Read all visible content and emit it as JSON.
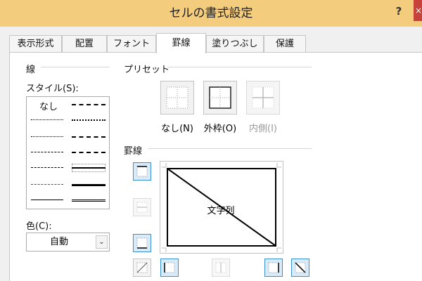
{
  "window": {
    "title": "セルの書式設定",
    "help": "?",
    "close": "×"
  },
  "tabs": [
    "表示形式",
    "配置",
    "フォント",
    "罫線",
    "塗りつぶし",
    "保護"
  ],
  "active_tab": "罫線",
  "line_group": {
    "label": "線",
    "style_label": "スタイル(S):",
    "style_none": "なし",
    "color_label": "色(C):",
    "color_value": "自動"
  },
  "preset_group": {
    "label": "プリセット",
    "none_label": "なし(N)",
    "outline_label": "外枠(O)",
    "inside_label": "内側(I)"
  },
  "border_group": {
    "label": "罫線",
    "preview_text": "文字列"
  },
  "colors": {
    "title_bar": "#f3cc7e",
    "close_button": "#c7423b",
    "selected_button_border": "#3c8fd0",
    "selected_button_fill": "#d7ebfb"
  },
  "icons": {
    "combo_arrow": "chevron-down-icon",
    "border_buttons": [
      "border-top-icon",
      "border-middle-horizontal-icon",
      "border-bottom-icon",
      "border-diagonal-up-icon",
      "border-left-icon",
      "border-middle-vertical-icon",
      "border-right-icon",
      "border-diagonal-down-icon"
    ]
  },
  "state": {
    "border_top": true,
    "border_middle_horizontal": false,
    "border_bottom": true,
    "border_diagonal_up": false,
    "border_left": true,
    "border_middle_vertical": false,
    "border_right": true,
    "border_diagonal_down": true
  }
}
